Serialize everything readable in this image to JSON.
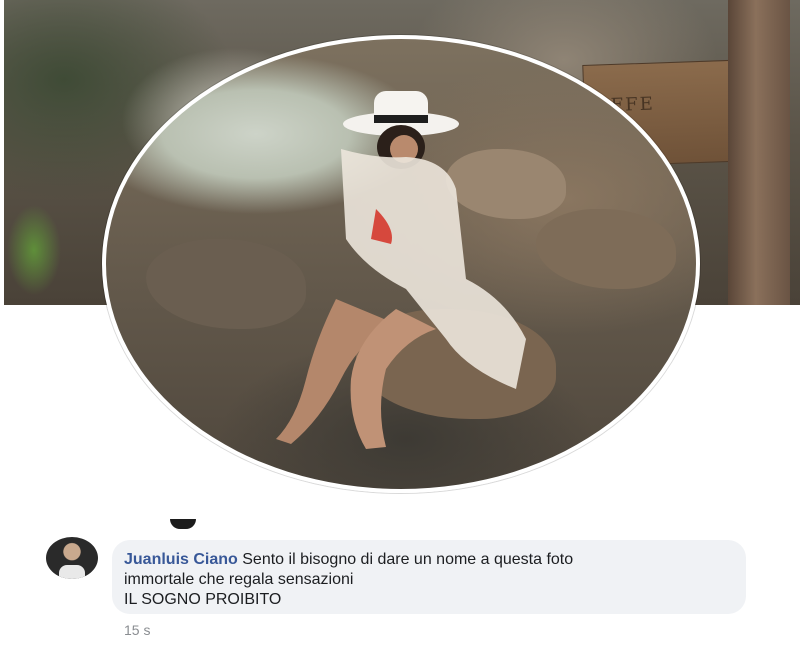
{
  "cover": {
    "sign_text": "FFE"
  },
  "comment": {
    "author": "Juanluis Ciano",
    "text_line1": "Sento il bisogno di dare un nome a questa foto",
    "text_line2": "immortale che regala sensazioni",
    "text_line3": "IL SOGNO PROIBITO",
    "time": "15 s"
  }
}
